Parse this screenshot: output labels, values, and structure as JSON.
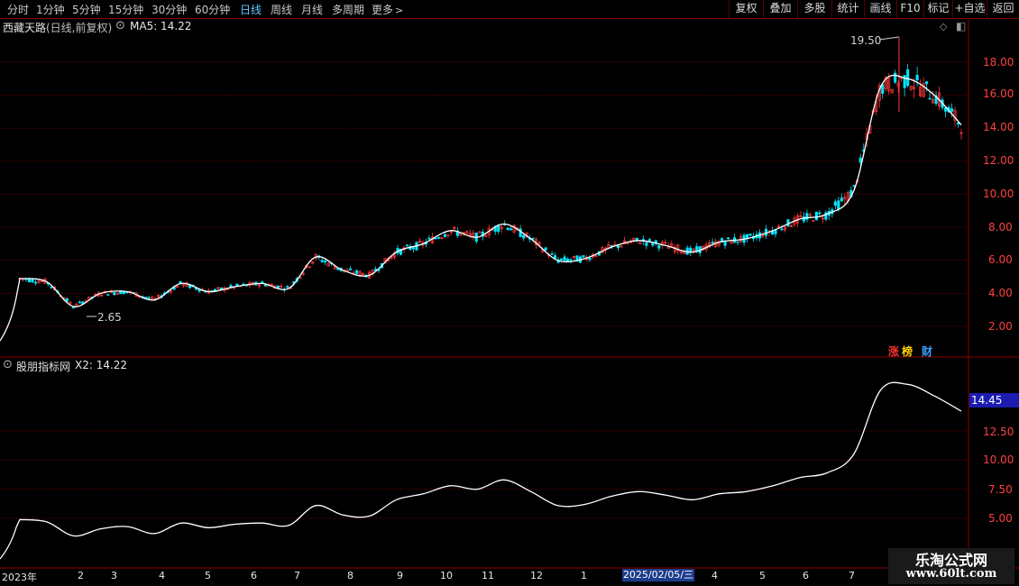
{
  "toolbar": {
    "periods": [
      "分时",
      "1分钟",
      "5分钟",
      "15分钟",
      "30分钟",
      "60分钟",
      "日线",
      "周线",
      "月线",
      "多周期",
      "更多"
    ],
    "active_period": "日线",
    "more_arrow": ">",
    "buttons": [
      "复权",
      "叠加",
      "多股",
      "统计",
      "画线",
      "F10",
      "标记",
      "+自选",
      "返回"
    ]
  },
  "main_panel": {
    "stock_name": "西藏天路",
    "chart_mode": "(日线,前复权)",
    "ma_label": "MA5: 14.22",
    "high_marker": "19.50",
    "low_marker": "2.65",
    "y_ticks": [
      "18.00",
      "16.00",
      "14.00",
      "12.00",
      "10.00",
      "8.00",
      "6.00",
      "4.00",
      "2.00"
    ],
    "badges": [
      {
        "text": "涨",
        "color": "#ff3030"
      },
      {
        "text": "榜",
        "color": "#ffd400"
      },
      {
        "text": "财",
        "color": "#3aa0ff"
      }
    ]
  },
  "sub_panel": {
    "indicator_name": "股朋指标网",
    "x2_label": "X2: 14.22",
    "current_value": "14.45",
    "y_ticks": [
      "12.50",
      "10.00",
      "7.50",
      "5.00"
    ]
  },
  "x_axis": {
    "start_label": "2023年",
    "months": [
      "2",
      "3",
      "4",
      "5",
      "6",
      "7",
      "8",
      "9",
      "10",
      "11",
      "12",
      "1",
      "2025/02/05/三",
      "4",
      "5",
      "6",
      "7"
    ]
  },
  "watermark": {
    "title": "乐淘公式网",
    "url": "www.60lt.com"
  },
  "colors": {
    "up": "#ff3a3a",
    "down": "#00e5ff",
    "line": "#ffffff",
    "grid": "#7a0000",
    "frame": "#8a0000"
  },
  "chart_data": {
    "type": "line",
    "x_axis": "date",
    "ma5_series": [
      4.9,
      4.7,
      3.2,
      4.0,
      4.1,
      3.6,
      4.6,
      4.1,
      4.4,
      4.6,
      4.3,
      6.2,
      5.4,
      5.1,
      6.5,
      7.0,
      7.8,
      7.4,
      8.2,
      7.3,
      6.0,
      6.1,
      6.8,
      7.2,
      6.9,
      6.5,
      7.1,
      7.3,
      7.8,
      8.5,
      8.8,
      10.2,
      16.5,
      17.0,
      16.0,
      14.2
    ],
    "x2_series": [
      4.9,
      4.7,
      3.5,
      4.1,
      4.3,
      3.7,
      4.6,
      4.2,
      4.5,
      4.6,
      4.4,
      6.1,
      5.3,
      5.2,
      6.6,
      7.1,
      7.8,
      7.5,
      8.3,
      7.3,
      6.1,
      6.2,
      6.9,
      7.3,
      7.0,
      6.6,
      7.1,
      7.3,
      7.8,
      8.5,
      8.9,
      10.5,
      16.0,
      16.5,
      15.5,
      14.2
    ],
    "annotations": {
      "high": 19.5,
      "low": 2.65
    }
  }
}
